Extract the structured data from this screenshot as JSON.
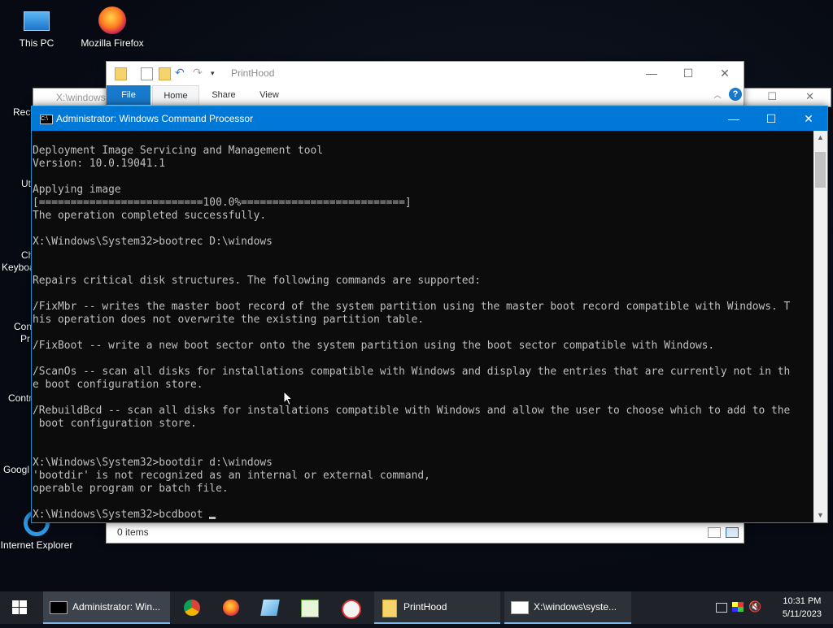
{
  "desktop": {
    "icons": [
      {
        "label": "This PC",
        "icon": "this-pc-icon"
      },
      {
        "label": "Mozilla Firefox",
        "icon": "firefox-icon"
      },
      {
        "label": "Internet Explorer",
        "icon": "internet-explorer-icon"
      }
    ],
    "partial_labels": [
      "Recy",
      "Ut",
      "Ch",
      "Keyboa",
      "Con",
      "Pr",
      "Contr",
      "Googl"
    ]
  },
  "back_window": {
    "title": "X:\\windows"
  },
  "explorer": {
    "title": "PrintHood",
    "tabs": [
      "File",
      "Home",
      "Share",
      "View"
    ],
    "help": "?",
    "status": "0 items"
  },
  "cmd": {
    "title": "Administrator: Windows Command Processor",
    "lines": [
      "Deployment Image Servicing and Management tool",
      "Version: 10.0.19041.1",
      "",
      "Applying image",
      "[==========================100.0%==========================]",
      "The operation completed successfully.",
      "",
      "X:\\Windows\\System32>bootrec D:\\windows",
      "",
      "",
      "Repairs critical disk structures. The following commands are supported:",
      "",
      "/FixMbr -- writes the master boot record of the system partition using the master boot record compatible with Windows. T",
      "his operation does not overwrite the existing partition table.",
      "",
      "/FixBoot -- write a new boot sector onto the system partition using the boot sector compatible with Windows.",
      "",
      "/ScanOs -- scan all disks for installations compatible with Windows and display the entries that are currently not in th",
      "e boot configuration store.",
      "",
      "/RebuildBcd -- scan all disks for installations compatible with Windows and allow the user to choose which to add to the",
      " boot configuration store.",
      "",
      "",
      "X:\\Windows\\System32>bootdir d:\\windows",
      "'bootdir' is not recognized as an internal or external command,",
      "operable program or batch file.",
      ""
    ],
    "prompt_line": "X:\\Windows\\System32>bcdboot "
  },
  "taskbar": {
    "items": [
      {
        "label": "Administrator: Win...",
        "icon": "cmd-icon",
        "state": "active"
      },
      {
        "icon": "chrome-icon"
      },
      {
        "icon": "firefox-icon"
      },
      {
        "icon": "notepad-icon"
      },
      {
        "icon": "editor-icon"
      },
      {
        "icon": "paint-icon"
      },
      {
        "label": "PrintHood",
        "icon": "folder-icon",
        "state": "open"
      },
      {
        "label": "X:\\windows\\syste...",
        "icon": "explorer-window-icon",
        "state": "open"
      }
    ],
    "time": "10:31 PM",
    "date": "5/11/2023"
  }
}
